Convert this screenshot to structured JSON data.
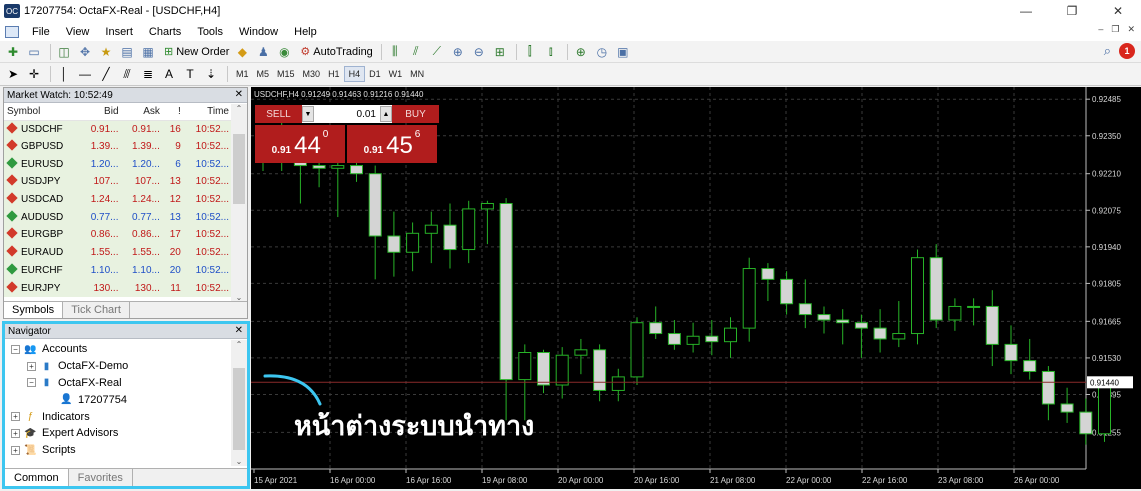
{
  "window": {
    "title": "17207754: OctaFX-Real - [USDCHF,H4]",
    "app_icon_label": "OC"
  },
  "menu": [
    "File",
    "View",
    "Insert",
    "Charts",
    "Tools",
    "Window",
    "Help"
  ],
  "toolbar": {
    "new_order_label": "New Order",
    "autotrading_label": "AutoTrading",
    "timeframes": [
      "M1",
      "M5",
      "M15",
      "M30",
      "H1",
      "H4",
      "D1",
      "W1",
      "MN"
    ],
    "active_timeframe": "H4",
    "notification_count": "1"
  },
  "market_watch": {
    "title": "Market Watch: 10:52:49",
    "columns": [
      "Symbol",
      "Bid",
      "Ask",
      "!",
      "Time"
    ],
    "rows": [
      {
        "symbol": "USDCHF",
        "bid": "0.91...",
        "ask": "0.91...",
        "spread": "16",
        "time": "10:52...",
        "dir": "down"
      },
      {
        "symbol": "GBPUSD",
        "bid": "1.39...",
        "ask": "1.39...",
        "spread": "9",
        "time": "10:52...",
        "dir": "down"
      },
      {
        "symbol": "EURUSD",
        "bid": "1.20...",
        "ask": "1.20...",
        "spread": "6",
        "time": "10:52...",
        "dir": "up"
      },
      {
        "symbol": "USDJPY",
        "bid": "107...",
        "ask": "107...",
        "spread": "13",
        "time": "10:52...",
        "dir": "down"
      },
      {
        "symbol": "USDCAD",
        "bid": "1.24...",
        "ask": "1.24...",
        "spread": "12",
        "time": "10:52...",
        "dir": "down"
      },
      {
        "symbol": "AUDUSD",
        "bid": "0.77...",
        "ask": "0.77...",
        "spread": "13",
        "time": "10:52...",
        "dir": "up"
      },
      {
        "symbol": "EURGBP",
        "bid": "0.86...",
        "ask": "0.86...",
        "spread": "17",
        "time": "10:52...",
        "dir": "down"
      },
      {
        "symbol": "EURAUD",
        "bid": "1.55...",
        "ask": "1.55...",
        "spread": "20",
        "time": "10:52...",
        "dir": "down"
      },
      {
        "symbol": "EURCHF",
        "bid": "1.10...",
        "ask": "1.10...",
        "spread": "20",
        "time": "10:52...",
        "dir": "up"
      },
      {
        "symbol": "EURJPY",
        "bid": "130...",
        "ask": "130...",
        "spread": "11",
        "time": "10:52...",
        "dir": "down"
      }
    ],
    "tabs": [
      "Symbols",
      "Tick Chart"
    ]
  },
  "navigator": {
    "title": "Navigator",
    "items": {
      "accounts": "Accounts",
      "demo": "OctaFX-Demo",
      "real": "OctaFX-Real",
      "account_id": "17207754",
      "indicators": "Indicators",
      "experts": "Expert Advisors",
      "scripts": "Scripts"
    },
    "tabs": [
      "Common",
      "Favorites"
    ]
  },
  "chart": {
    "info": "USDCHF,H4  0.91249 0.91463 0.91216 0.91440",
    "trade": {
      "sell_label": "SELL",
      "buy_label": "BUY",
      "volume": "0.01",
      "sell_small": "0.91",
      "sell_big": "44",
      "sell_sup": "0",
      "buy_small": "0.91",
      "buy_big": "45",
      "buy_sup": "6"
    },
    "current_price": "0.91440"
  },
  "callout_text": "หน้าต่างระบบนำทาง",
  "chart_data": {
    "type": "candlestick",
    "symbol": "USDCHF",
    "timeframe": "H4",
    "ylim": [
      0.9112,
      0.9253
    ],
    "y_ticks": [
      "0.92485",
      "0.92350",
      "0.92210",
      "0.92075",
      "0.91940",
      "0.91805",
      "0.91665",
      "0.91530",
      "0.91395",
      "0.91255"
    ],
    "x_ticks": [
      "15 Apr 2021",
      "16 Apr 00:00",
      "16 Apr 16:00",
      "19 Apr 08:00",
      "20 Apr 00:00",
      "20 Apr 16:00",
      "21 Apr 08:00",
      "22 Apr 00:00",
      "22 Apr 16:00",
      "23 Apr 08:00",
      "26 Apr 00:00"
    ],
    "candles": [
      [
        0.9228,
        0.9238,
        0.9222,
        0.9231
      ],
      [
        0.9231,
        0.9245,
        0.9222,
        0.9226
      ],
      [
        0.9226,
        0.9232,
        0.921,
        0.9224
      ],
      [
        0.9224,
        0.9229,
        0.9216,
        0.9223
      ],
      [
        0.9223,
        0.9228,
        0.9205,
        0.9224
      ],
      [
        0.9224,
        0.9235,
        0.9218,
        0.9221
      ],
      [
        0.9221,
        0.9224,
        0.9182,
        0.9198
      ],
      [
        0.9198,
        0.9207,
        0.9183,
        0.9192
      ],
      [
        0.9192,
        0.9203,
        0.9185,
        0.9199
      ],
      [
        0.9199,
        0.9207,
        0.9188,
        0.9202
      ],
      [
        0.9202,
        0.921,
        0.9186,
        0.9193
      ],
      [
        0.9193,
        0.9211,
        0.9188,
        0.9208
      ],
      [
        0.9208,
        0.9211,
        0.9195,
        0.921
      ],
      [
        0.921,
        0.9212,
        0.913,
        0.9145
      ],
      [
        0.9145,
        0.9158,
        0.913,
        0.9155
      ],
      [
        0.9155,
        0.9156,
        0.914,
        0.9143
      ],
      [
        0.9143,
        0.9157,
        0.9138,
        0.9154
      ],
      [
        0.9154,
        0.916,
        0.9147,
        0.9156
      ],
      [
        0.9156,
        0.9158,
        0.9137,
        0.9141
      ],
      [
        0.9141,
        0.9149,
        0.9137,
        0.9146
      ],
      [
        0.9146,
        0.9168,
        0.9143,
        0.9166
      ],
      [
        0.9166,
        0.9172,
        0.916,
        0.9162
      ],
      [
        0.9162,
        0.9167,
        0.9156,
        0.9158
      ],
      [
        0.9158,
        0.9166,
        0.9155,
        0.9161
      ],
      [
        0.9161,
        0.9167,
        0.9154,
        0.9159
      ],
      [
        0.9159,
        0.9168,
        0.9153,
        0.9164
      ],
      [
        0.9164,
        0.919,
        0.9159,
        0.9186
      ],
      [
        0.9186,
        0.9188,
        0.9174,
        0.9182
      ],
      [
        0.9182,
        0.9185,
        0.9169,
        0.9173
      ],
      [
        0.9173,
        0.9182,
        0.9164,
        0.9169
      ],
      [
        0.9169,
        0.9172,
        0.9162,
        0.9167
      ],
      [
        0.9167,
        0.9171,
        0.9158,
        0.9166
      ],
      [
        0.9166,
        0.9169,
        0.9153,
        0.9164
      ],
      [
        0.9164,
        0.9171,
        0.9155,
        0.916
      ],
      [
        0.916,
        0.9174,
        0.9157,
        0.9162
      ],
      [
        0.9162,
        0.9193,
        0.9158,
        0.919
      ],
      [
        0.919,
        0.9195,
        0.9164,
        0.9167
      ],
      [
        0.9167,
        0.9175,
        0.9163,
        0.9172
      ],
      [
        0.9172,
        0.9175,
        0.9165,
        0.9172
      ],
      [
        0.9172,
        0.9178,
        0.915,
        0.9158
      ],
      [
        0.9158,
        0.9165,
        0.9147,
        0.9152
      ],
      [
        0.9152,
        0.916,
        0.9145,
        0.9148
      ],
      [
        0.9148,
        0.915,
        0.913,
        0.9136
      ],
      [
        0.9136,
        0.9142,
        0.9129,
        0.9133
      ],
      [
        0.9133,
        0.9138,
        0.9121,
        0.9125
      ],
      [
        0.9125,
        0.9146,
        0.9122,
        0.9144
      ]
    ]
  }
}
